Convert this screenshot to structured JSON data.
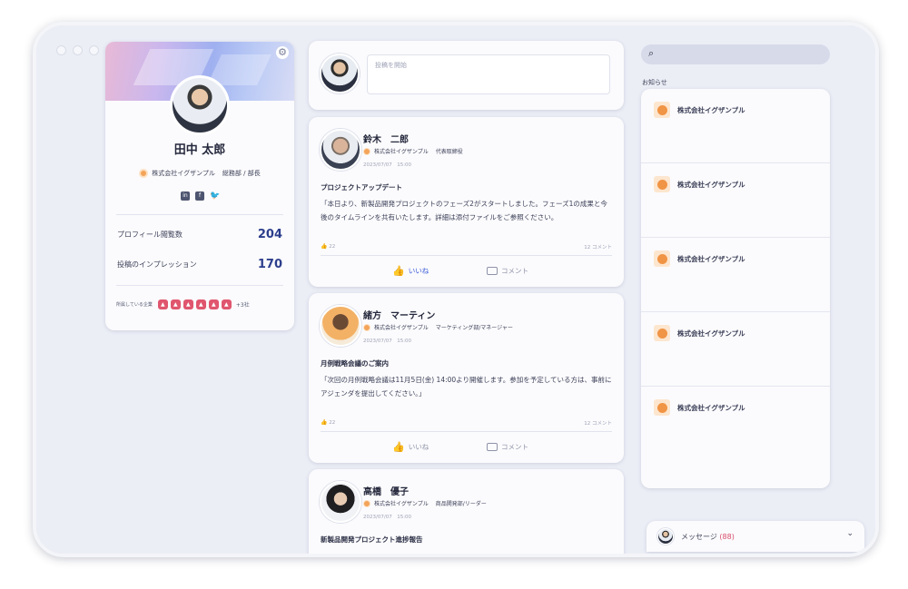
{
  "profile": {
    "name": "田中 太郎",
    "company": "株式会社イグザンプル",
    "position": "総務部 / 部長",
    "socials": [
      "in",
      "f",
      "🐦"
    ],
    "stats": [
      {
        "label": "プロフィール閲覧数",
        "value": "204"
      },
      {
        "label": "投稿のインプレッション",
        "value": "170"
      }
    ],
    "companies_label": "所属している企業",
    "companies_more": "+3社",
    "gear_icon": "gear-icon"
  },
  "composer": {
    "placeholder": "投稿を開始"
  },
  "posts": [
    {
      "name": "鈴木　二郎",
      "company": "株式会社イグザンプル",
      "role": "代表取締役",
      "date": "2023/07/07　15:00",
      "title": "プロジェクトアップデート",
      "body": "「本日より、新製品開発プロジェクトのフェーズ2がスタートしました。フェーズ1の成果と今後のタイムラインを共有いたします。詳細は添付ファイルをご参照ください。",
      "likes": "22",
      "comments": "12 コメント",
      "like_label": "いいね",
      "comment_label": "コメント"
    },
    {
      "name": "緒方　マーティン",
      "company": "株式会社イグザンプル",
      "role": "マーケティング部/マネージャー",
      "date": "2023/07/07　15:00",
      "title": "月例戦略会議のご案内",
      "body": "「次回の月例戦略会議は11月5日(金) 14:00より開催します。参加を予定している方は、事前にアジェンダを提出してください。」",
      "likes": "22",
      "comments": "12 コメント",
      "like_label": "いいね",
      "comment_label": "コメント"
    },
    {
      "name": "高橋　優子",
      "company": "株式会社イグザンプル",
      "role": "商品開発部/リーダー",
      "date": "2023/07/07　15:00",
      "title": "新製品開発プロジェクト進捗報告"
    }
  ],
  "sidebar": {
    "notice_label": "お知らせ",
    "notices": [
      "株式会社イグザンプル",
      "株式会社イグザンプル",
      "株式会社イグザンプル",
      "株式会社イグザンプル",
      "株式会社イグザンプル"
    ],
    "messages_label": "メッセージ",
    "messages_count": "(88)"
  }
}
